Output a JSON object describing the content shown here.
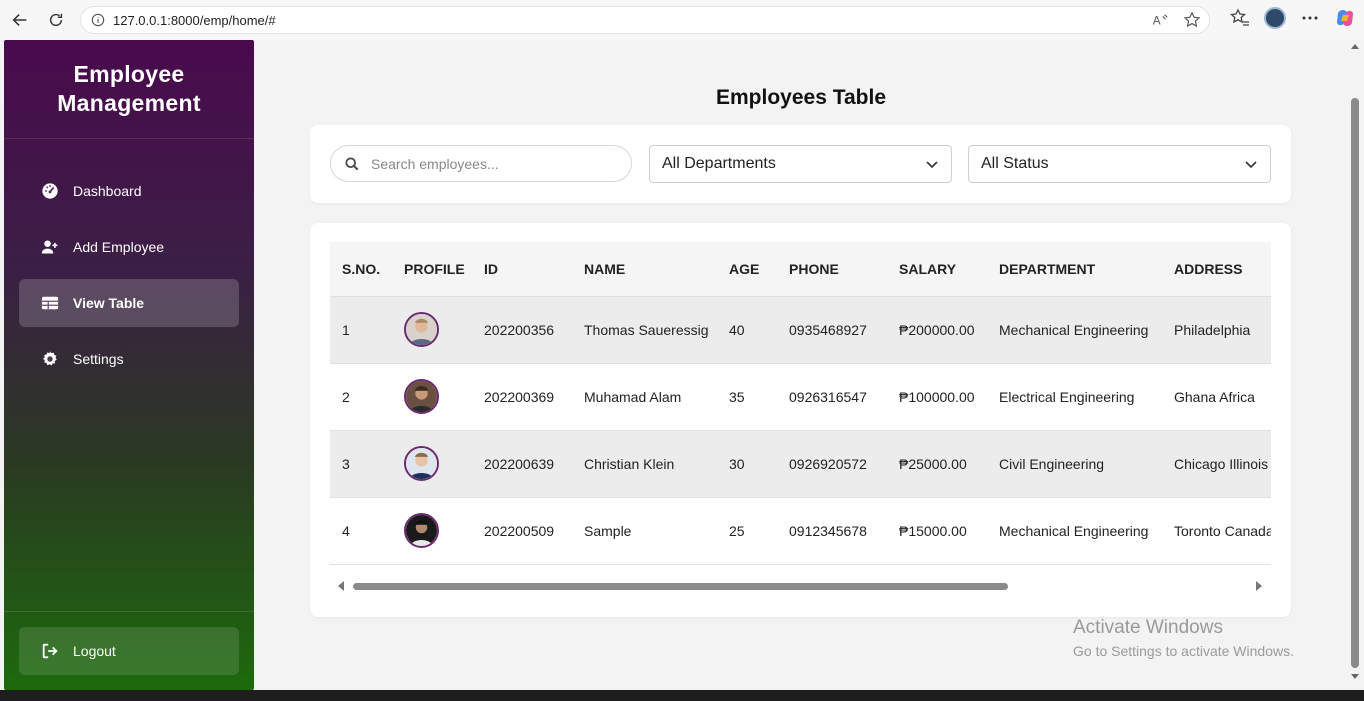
{
  "browser": {
    "url": "127.0.0.1:8000/emp/home/#"
  },
  "sidebar": {
    "brand_line1": "Employee",
    "brand_line2": "Management",
    "items": [
      {
        "label": "Dashboard",
        "icon": "gauge-icon",
        "active": false
      },
      {
        "label": "Add Employee",
        "icon": "user-plus-icon",
        "active": false
      },
      {
        "label": "View Table",
        "icon": "table-icon",
        "active": true
      },
      {
        "label": "Settings",
        "icon": "gear-icon",
        "active": false
      }
    ],
    "logout_label": "Logout"
  },
  "main": {
    "title": "Employees Table",
    "filters": {
      "search_placeholder": "Search employees...",
      "department_value": "All Departments",
      "status_value": "All Status"
    },
    "table": {
      "columns": [
        "S.NO.",
        "PROFILE",
        "ID",
        "NAME",
        "AGE",
        "PHONE",
        "SALARY",
        "DEPARTMENT",
        "ADDRESS"
      ],
      "rows": [
        {
          "sno": "1",
          "id": "202200356",
          "name": "Thomas Saueressig",
          "age": "40",
          "phone": "0935468927",
          "salary": "₱200000.00",
          "department": "Mechanical Engineering",
          "address": "Philadelphia"
        },
        {
          "sno": "2",
          "id": "202200369",
          "name": "Muhamad Alam",
          "age": "35",
          "phone": "0926316547",
          "salary": "₱100000.00",
          "department": "Electrical Engineering",
          "address": "Ghana Africa"
        },
        {
          "sno": "3",
          "id": "202200639",
          "name": "Christian Klein",
          "age": "30",
          "phone": "0926920572",
          "salary": "₱25000.00",
          "department": "Civil Engineering",
          "address": "Chicago Illinois"
        },
        {
          "sno": "4",
          "id": "202200509",
          "name": "Sample",
          "age": "25",
          "phone": "0912345678",
          "salary": "₱15000.00",
          "department": "Mechanical Engineering",
          "address": "Toronto Canada"
        }
      ]
    }
  },
  "watermark": {
    "line1": "Activate Windows",
    "line2": "Go to Settings to activate Windows."
  },
  "colors": {
    "sidebar_top": "#4a0a4e",
    "sidebar_bottom": "#1d6a0d",
    "avatar_border": "#6a2a6f"
  }
}
